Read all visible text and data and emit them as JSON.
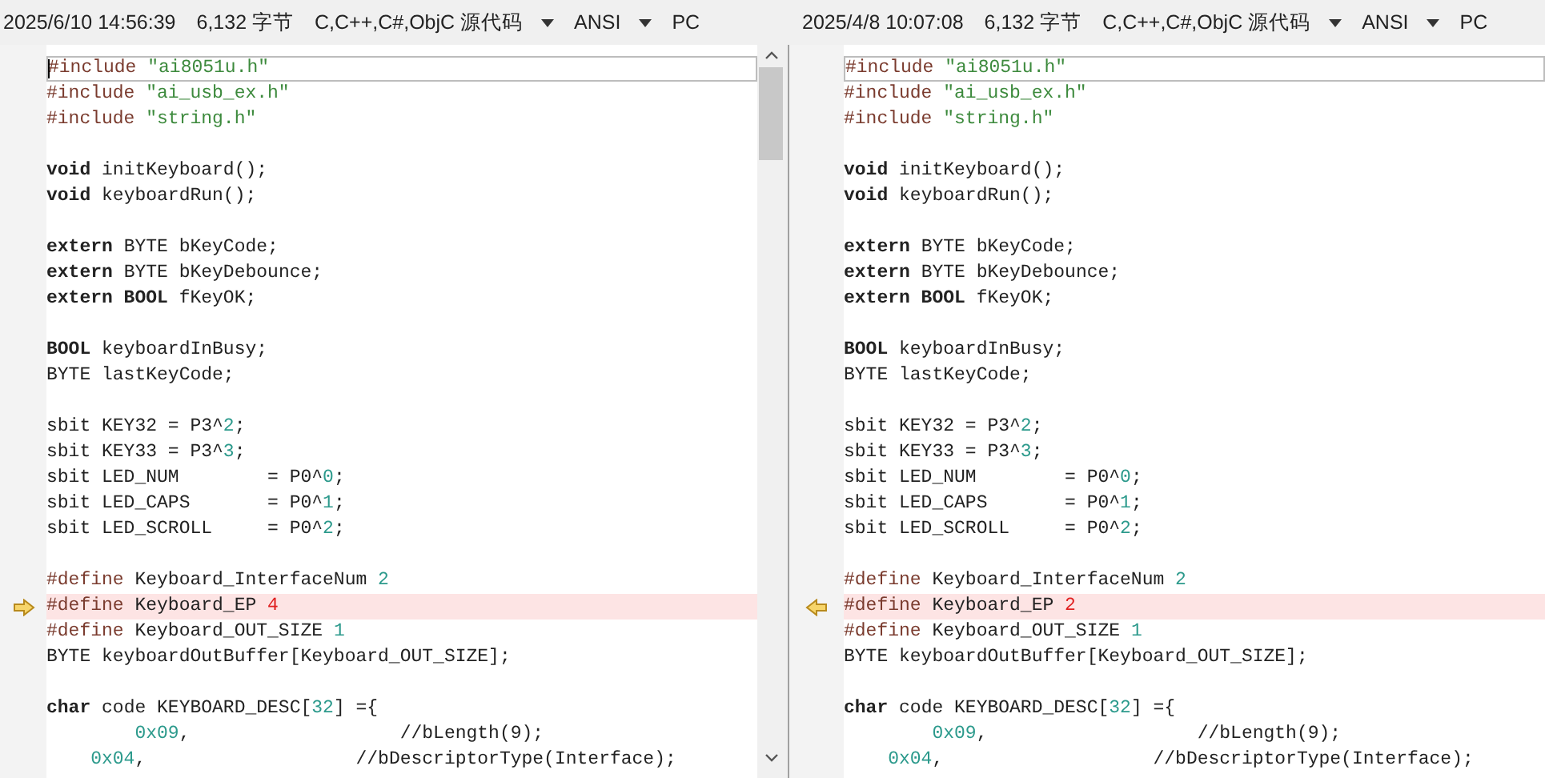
{
  "panes": [
    {
      "info": {
        "date": "2025/6/10 14:56:39",
        "size": "6,132 字节",
        "language": "C,C++,C#,ObjC 源代码",
        "encoding": "ANSI",
        "line_end": "PC"
      },
      "scrollbar": true,
      "cursor": true,
      "lines": [
        {
          "current": true,
          "changed": false,
          "tokens": [
            {
              "kind": "pre",
              "t": "#include"
            },
            {
              "kind": "str",
              "t": " \"ai8051u.h\""
            }
          ]
        },
        {
          "changed": false,
          "tokens": [
            {
              "kind": "pre",
              "t": "#include"
            },
            {
              "kind": "str",
              "t": " \"ai_usb_ex.h\""
            }
          ]
        },
        {
          "changed": false,
          "tokens": [
            {
              "kind": "pre",
              "t": "#include"
            },
            {
              "kind": "str",
              "t": " \"string.h\""
            }
          ]
        },
        {
          "changed": false
        },
        {
          "changed": false,
          "tokens": [
            {
              "kind": "kw",
              "t": "void"
            },
            {
              "kind": "plain",
              "t": " initKeyboard();"
            }
          ]
        },
        {
          "changed": false,
          "tokens": [
            {
              "kind": "kw",
              "t": "void"
            },
            {
              "kind": "plain",
              "t": " keyboardRun();"
            }
          ]
        },
        {
          "changed": false
        },
        {
          "changed": false,
          "tokens": [
            {
              "kind": "kw",
              "t": "extern"
            },
            {
              "kind": "plain",
              "t": " BYTE bKeyCode;"
            }
          ]
        },
        {
          "changed": false,
          "tokens": [
            {
              "kind": "kw",
              "t": "extern"
            },
            {
              "kind": "plain",
              "t": " BYTE bKeyDebounce;"
            }
          ]
        },
        {
          "changed": false,
          "tokens": [
            {
              "kind": "kw",
              "t": "extern BOOL"
            },
            {
              "kind": "plain",
              "t": " fKeyOK;"
            }
          ]
        },
        {
          "changed": false
        },
        {
          "changed": false,
          "tokens": [
            {
              "kind": "kw",
              "t": "BOOL"
            },
            {
              "kind": "plain",
              "t": " keyboardInBusy;"
            }
          ]
        },
        {
          "changed": false,
          "tokens": [
            {
              "kind": "plain",
              "t": "BYTE lastKeyCode;"
            }
          ]
        },
        {
          "changed": false
        },
        {
          "changed": false,
          "tokens": [
            {
              "kind": "plain",
              "t": "sbit KEY32 = P3^"
            },
            {
              "kind": "num",
              "t": "2"
            },
            {
              "kind": "plain",
              "t": ";"
            }
          ]
        },
        {
          "changed": false,
          "tokens": [
            {
              "kind": "plain",
              "t": "sbit KEY33 = P3^"
            },
            {
              "kind": "num",
              "t": "3"
            },
            {
              "kind": "plain",
              "t": ";"
            }
          ]
        },
        {
          "changed": false,
          "tokens": [
            {
              "kind": "plain",
              "t": "sbit LED_NUM        = P0^"
            },
            {
              "kind": "num",
              "t": "0"
            },
            {
              "kind": "plain",
              "t": ";"
            }
          ]
        },
        {
          "changed": false,
          "tokens": [
            {
              "kind": "plain",
              "t": "sbit LED_CAPS       = P0^"
            },
            {
              "kind": "num",
              "t": "1"
            },
            {
              "kind": "plain",
              "t": ";"
            }
          ]
        },
        {
          "changed": false,
          "tokens": [
            {
              "kind": "plain",
              "t": "sbit LED_SCROLL     = P0^"
            },
            {
              "kind": "num",
              "t": "2"
            },
            {
              "kind": "plain",
              "t": ";"
            }
          ]
        },
        {
          "changed": false
        },
        {
          "changed": false,
          "tokens": [
            {
              "kind": "pre",
              "t": "#define"
            },
            {
              "kind": "plain",
              "t": " Keyboard_InterfaceNum"
            },
            {
              "kind": "num",
              "t": " 2"
            }
          ]
        },
        {
          "changed": true,
          "kind": "arrow-right",
          "tokens": [
            {
              "kind": "pre",
              "t": "#define"
            },
            {
              "kind": "plain",
              "t": " Keyboard_EP"
            },
            {
              "kind": "diff",
              "t": " 4"
            }
          ]
        },
        {
          "changed": false,
          "tokens": [
            {
              "kind": "pre",
              "t": "#define"
            },
            {
              "kind": "plain",
              "t": " Keyboard_OUT_SIZE"
            },
            {
              "kind": "num",
              "t": " 1"
            }
          ]
        },
        {
          "changed": false,
          "tokens": [
            {
              "kind": "plain",
              "t": "BYTE keyboardOutBuffer[Keyboard_OUT_SIZE];"
            }
          ]
        },
        {
          "changed": false
        },
        {
          "changed": false,
          "tokens": [
            {
              "kind": "kw",
              "t": "char"
            },
            {
              "kind": "plain",
              "t": " code KEYBOARD_DESC["
            },
            {
              "kind": "num",
              "t": "32"
            },
            {
              "kind": "plain",
              "t": "] ={"
            }
          ]
        },
        {
          "changed": false,
          "tokens": [
            {
              "kind": "num",
              "t": "        0x09"
            },
            {
              "kind": "plain",
              "t": ",                   //bLength(9);"
            }
          ]
        },
        {
          "changed": false,
          "tokens": [
            {
              "kind": "num",
              "t": "    0x04"
            },
            {
              "kind": "plain",
              "t": ",                   //bDescriptorType(Interface);"
            }
          ]
        }
      ]
    },
    {
      "info": {
        "date": "2025/4/8 10:07:08",
        "size": "6,132 字节",
        "language": "C,C++,C#,ObjC 源代码",
        "encoding": "ANSI",
        "line_end": "PC"
      },
      "scrollbar": false,
      "cursor": false,
      "lines": [
        {
          "current": true,
          "changed": false,
          "tokens": [
            {
              "kind": "pre",
              "t": "#include"
            },
            {
              "kind": "str",
              "t": " \"ai8051u.h\""
            }
          ]
        },
        {
          "changed": false,
          "tokens": [
            {
              "kind": "pre",
              "t": "#include"
            },
            {
              "kind": "str",
              "t": " \"ai_usb_ex.h\""
            }
          ]
        },
        {
          "changed": false,
          "tokens": [
            {
              "kind": "pre",
              "t": "#include"
            },
            {
              "kind": "str",
              "t": " \"string.h\""
            }
          ]
        },
        {
          "changed": false
        },
        {
          "changed": false,
          "tokens": [
            {
              "kind": "kw",
              "t": "void"
            },
            {
              "kind": "plain",
              "t": " initKeyboard();"
            }
          ]
        },
        {
          "changed": false,
          "tokens": [
            {
              "kind": "kw",
              "t": "void"
            },
            {
              "kind": "plain",
              "t": " keyboardRun();"
            }
          ]
        },
        {
          "changed": false
        },
        {
          "changed": false,
          "tokens": [
            {
              "kind": "kw",
              "t": "extern"
            },
            {
              "kind": "plain",
              "t": " BYTE bKeyCode;"
            }
          ]
        },
        {
          "changed": false,
          "tokens": [
            {
              "kind": "kw",
              "t": "extern"
            },
            {
              "kind": "plain",
              "t": " BYTE bKeyDebounce;"
            }
          ]
        },
        {
          "changed": false,
          "tokens": [
            {
              "kind": "kw",
              "t": "extern BOOL"
            },
            {
              "kind": "plain",
              "t": " fKeyOK;"
            }
          ]
        },
        {
          "changed": false
        },
        {
          "changed": false,
          "tokens": [
            {
              "kind": "kw",
              "t": "BOOL"
            },
            {
              "kind": "plain",
              "t": " keyboardInBusy;"
            }
          ]
        },
        {
          "changed": false,
          "tokens": [
            {
              "kind": "plain",
              "t": "BYTE lastKeyCode;"
            }
          ]
        },
        {
          "changed": false
        },
        {
          "changed": false,
          "tokens": [
            {
              "kind": "plain",
              "t": "sbit KEY32 = P3^"
            },
            {
              "kind": "num",
              "t": "2"
            },
            {
              "kind": "plain",
              "t": ";"
            }
          ]
        },
        {
          "changed": false,
          "tokens": [
            {
              "kind": "plain",
              "t": "sbit KEY33 = P3^"
            },
            {
              "kind": "num",
              "t": "3"
            },
            {
              "kind": "plain",
              "t": ";"
            }
          ]
        },
        {
          "changed": false,
          "tokens": [
            {
              "kind": "plain",
              "t": "sbit LED_NUM        = P0^"
            },
            {
              "kind": "num",
              "t": "0"
            },
            {
              "kind": "plain",
              "t": ";"
            }
          ]
        },
        {
          "changed": false,
          "tokens": [
            {
              "kind": "plain",
              "t": "sbit LED_CAPS       = P0^"
            },
            {
              "kind": "num",
              "t": "1"
            },
            {
              "kind": "plain",
              "t": ";"
            }
          ]
        },
        {
          "changed": false,
          "tokens": [
            {
              "kind": "plain",
              "t": "sbit LED_SCROLL     = P0^"
            },
            {
              "kind": "num",
              "t": "2"
            },
            {
              "kind": "plain",
              "t": ";"
            }
          ]
        },
        {
          "changed": false
        },
        {
          "changed": false,
          "tokens": [
            {
              "kind": "pre",
              "t": "#define"
            },
            {
              "kind": "plain",
              "t": " Keyboard_InterfaceNum"
            },
            {
              "kind": "num",
              "t": " 2"
            }
          ]
        },
        {
          "changed": true,
          "kind": "arrow-left",
          "tokens": [
            {
              "kind": "pre",
              "t": "#define"
            },
            {
              "kind": "plain",
              "t": " Keyboard_EP"
            },
            {
              "kind": "diff",
              "t": " 2"
            }
          ]
        },
        {
          "changed": false,
          "tokens": [
            {
              "kind": "pre",
              "t": "#define"
            },
            {
              "kind": "plain",
              "t": " Keyboard_OUT_SIZE"
            },
            {
              "kind": "num",
              "t": " 1"
            }
          ]
        },
        {
          "changed": false,
          "tokens": [
            {
              "kind": "plain",
              "t": "BYTE keyboardOutBuffer[Keyboard_OUT_SIZE];"
            }
          ]
        },
        {
          "changed": false
        },
        {
          "changed": false,
          "tokens": [
            {
              "kind": "kw",
              "t": "char"
            },
            {
              "kind": "plain",
              "t": " code KEYBOARD_DESC["
            },
            {
              "kind": "num",
              "t": "32"
            },
            {
              "kind": "plain",
              "t": "] ={"
            }
          ]
        },
        {
          "changed": false,
          "tokens": [
            {
              "kind": "num",
              "t": "        0x09"
            },
            {
              "kind": "plain",
              "t": ",                   //bLength(9);"
            }
          ]
        },
        {
          "changed": false,
          "tokens": [
            {
              "kind": "num",
              "t": "    0x04"
            },
            {
              "kind": "plain",
              "t": ",                   //bDescriptorType(Interface);"
            }
          ]
        }
      ]
    }
  ]
}
